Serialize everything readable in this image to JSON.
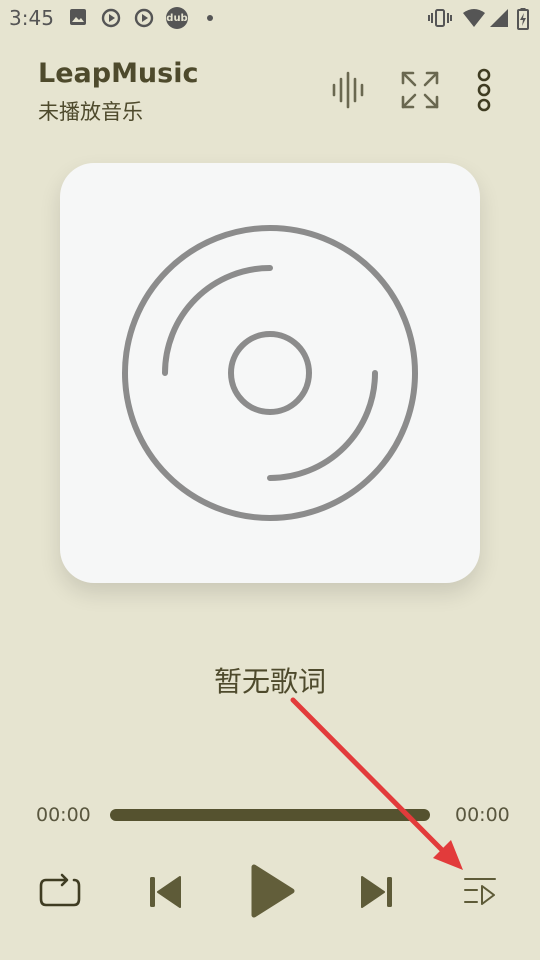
{
  "status_bar": {
    "time": "3:45",
    "icons": [
      "image-icon",
      "sync-icon",
      "sync-icon",
      "dub-icon",
      "dot-icon",
      "vibrate-icon",
      "wifi-icon",
      "signal-icon",
      "battery-icon"
    ],
    "dub_label": "dub"
  },
  "header": {
    "title": "LeapMusic",
    "subtitle": "未播放音乐",
    "actions": [
      "equalizer-icon",
      "fullscreen-icon",
      "more-vertical-icon"
    ]
  },
  "player": {
    "lyrics": "暂无歌词",
    "current_time": "00:00",
    "total_time": "00:00",
    "progress": 0
  },
  "controls": [
    "repeat-icon",
    "previous-icon",
    "play-icon",
    "next-icon",
    "playlist-icon"
  ],
  "colors": {
    "background": "#e6e4d0",
    "accent": "#55522f",
    "card": "#f6f7f7",
    "disc": "#8c8c8c",
    "annotation": "#e23b3b"
  }
}
